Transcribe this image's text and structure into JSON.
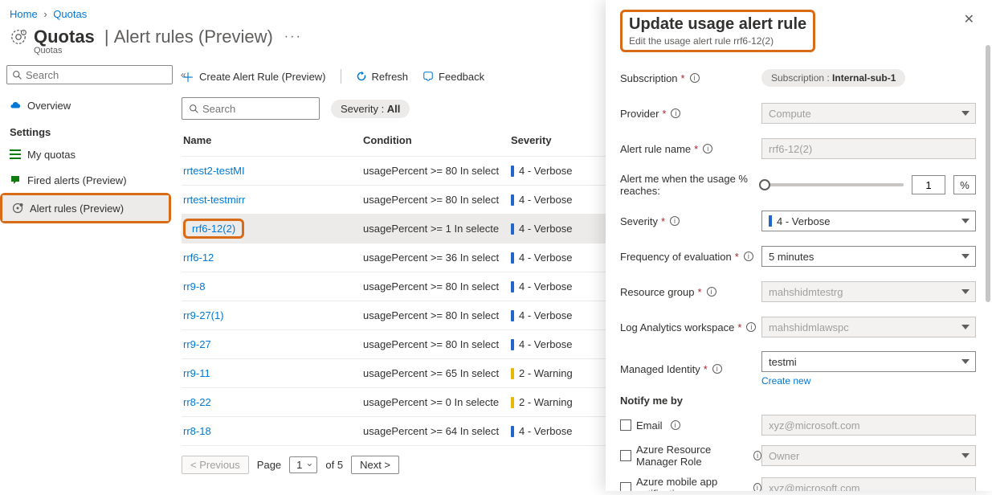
{
  "breadcrumb": {
    "home": "Home",
    "quotas": "Quotas"
  },
  "header": {
    "title": "Quotas",
    "section": "Alert rules (Preview)",
    "subtitle": "Quotas"
  },
  "sidebar": {
    "search_placeholder": "Search",
    "items": {
      "overview": "Overview",
      "settings_heading": "Settings",
      "my_quotas": "My quotas",
      "fired_alerts": "Fired alerts (Preview)",
      "alert_rules": "Alert rules (Preview)"
    }
  },
  "toolbar": {
    "create": "Create Alert Rule (Preview)",
    "refresh": "Refresh",
    "feedback": "Feedback"
  },
  "filters": {
    "search_placeholder": "Search",
    "severity_label": "Severity : ",
    "severity_value": "All"
  },
  "table": {
    "headers": {
      "name": "Name",
      "condition": "Condition",
      "severity": "Severity"
    },
    "rows": [
      {
        "name": "rrtest2-testMI",
        "condition": "usagePercent >= 80 In select",
        "severity": "4 - Verbose",
        "sevClass": "v"
      },
      {
        "name": "rrtest-testmirr",
        "condition": "usagePercent >= 80 In select",
        "severity": "4 - Verbose",
        "sevClass": "v"
      },
      {
        "name": "rrf6-12(2)",
        "condition": "usagePercent >= 1 In selecte",
        "severity": "4 - Verbose",
        "sevClass": "v",
        "selected": true,
        "highlightName": true
      },
      {
        "name": "rrf6-12",
        "condition": "usagePercent >= 36 In select",
        "severity": "4 - Verbose",
        "sevClass": "v"
      },
      {
        "name": "rr9-8",
        "condition": "usagePercent >= 80 In select",
        "severity": "4 - Verbose",
        "sevClass": "v"
      },
      {
        "name": "rr9-27(1)",
        "condition": "usagePercent >= 80 In select",
        "severity": "4 - Verbose",
        "sevClass": "v"
      },
      {
        "name": "rr9-27",
        "condition": "usagePercent >= 80 In select",
        "severity": "4 - Verbose",
        "sevClass": "v"
      },
      {
        "name": "rr9-11",
        "condition": "usagePercent >= 65 In select",
        "severity": "2 - Warning",
        "sevClass": "w"
      },
      {
        "name": "rr8-22",
        "condition": "usagePercent >= 0 In selecte",
        "severity": "2 - Warning",
        "sevClass": "w"
      },
      {
        "name": "rr8-18",
        "condition": "usagePercent >= 64 In select",
        "severity": "4 - Verbose",
        "sevClass": "v"
      }
    ]
  },
  "pagination": {
    "prev": "< Previous",
    "page_label": "Page",
    "page_value": "1",
    "of_label": "of 5",
    "next": "Next >"
  },
  "panel": {
    "title": "Update usage alert rule",
    "subtitle": "Edit the usage alert rule rrf6-12(2)",
    "labels": {
      "subscription": "Subscription",
      "provider": "Provider",
      "alert_rule_name": "Alert rule name",
      "alert_when": "Alert me when the usage % reaches:",
      "severity": "Severity",
      "frequency": "Frequency of evaluation",
      "resource_group": "Resource group",
      "law": "Log Analytics workspace",
      "managed_identity": "Managed Identity",
      "notify_heading": "Notify me by",
      "email": "Email",
      "arm_role": "Azure Resource Manager Role",
      "mobile": "Azure mobile app notification"
    },
    "values": {
      "subscription_prefix": "Subscription : ",
      "subscription_value": "Internal-sub-1",
      "provider": "Compute",
      "alert_rule_name": "rrf6-12(2)",
      "slider_value": "1",
      "slider_unit": "%",
      "severity": "4 - Verbose",
      "frequency": "5 minutes",
      "resource_group": "mahshidmtestrg",
      "law": "mahshidmlawspc",
      "managed_identity": "testmi",
      "create_new": "Create new",
      "email_placeholder": "xyz@microsoft.com",
      "arm_role_placeholder": "Owner",
      "mobile_placeholder": "xyz@microsoft.com"
    }
  }
}
